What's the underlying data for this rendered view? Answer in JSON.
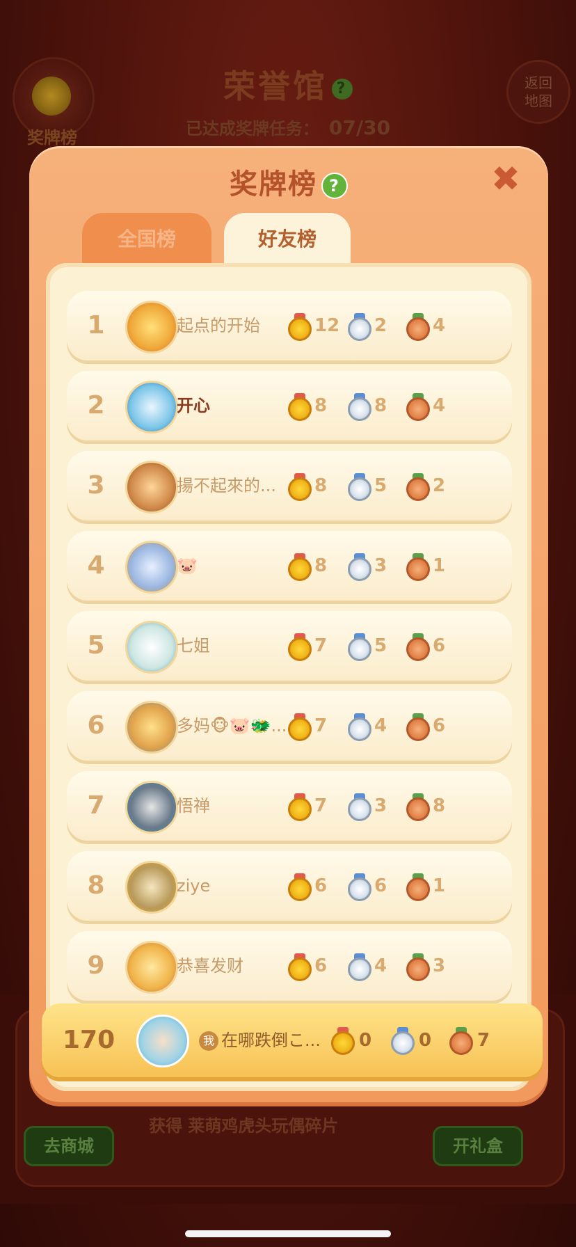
{
  "background": {
    "title": "荣誉馆",
    "help_icon": "?",
    "progress_label": "已达成奖牌任务：",
    "progress_value": "07/30",
    "left_button_label": "奖牌榜",
    "right_button_label": "返回\n地图",
    "shop_button": "去商城",
    "gift_button": "开礼盒",
    "reward_text": "获得 莱萌鸡虎头玩偶碎片"
  },
  "modal": {
    "title": "奖牌榜",
    "help_icon": "?",
    "close_icon": "✖",
    "tabs": [
      {
        "label": "全国榜",
        "active": false
      },
      {
        "label": "好友榜",
        "active": true
      }
    ]
  },
  "leaderboard": [
    {
      "rank": "1",
      "name": "起点的开始",
      "gold": "12",
      "silver": "2",
      "bronze": "4",
      "avatar": "avatar-icon"
    },
    {
      "rank": "2",
      "name": "开心",
      "gold": "8",
      "silver": "8",
      "bronze": "4",
      "avatar": "avatar-icon"
    },
    {
      "rank": "3",
      "name": "揚不起來的...",
      "gold": "8",
      "silver": "5",
      "bronze": "2",
      "avatar": "avatar-icon"
    },
    {
      "rank": "4",
      "name": "🐷",
      "gold": "8",
      "silver": "3",
      "bronze": "1",
      "avatar": "avatar-icon"
    },
    {
      "rank": "5",
      "name": "七姐",
      "gold": "7",
      "silver": "5",
      "bronze": "6",
      "avatar": "avatar-icon"
    },
    {
      "rank": "6",
      "name": "多妈🐵🐷🐲...",
      "gold": "7",
      "silver": "4",
      "bronze": "6",
      "avatar": "avatar-icon"
    },
    {
      "rank": "7",
      "name": "悟禅",
      "gold": "7",
      "silver": "3",
      "bronze": "8",
      "avatar": "avatar-icon"
    },
    {
      "rank": "8",
      "name": "ziye",
      "gold": "6",
      "silver": "6",
      "bronze": "1",
      "avatar": "avatar-icon"
    },
    {
      "rank": "9",
      "name": "恭喜发财",
      "gold": "6",
      "silver": "4",
      "bronze": "3",
      "avatar": "avatar-icon"
    }
  ],
  "my_entry": {
    "rank": "170",
    "badge": "我",
    "name": "在哪跌倒こ...",
    "gold": "0",
    "silver": "0",
    "bronze": "7"
  },
  "colors": {
    "gold_medal": "#f0b51a",
    "silver_medal": "#dbe4ee",
    "bronze_medal": "#e2844a",
    "modal_bg": "#f29a5d",
    "help_green": "#62b33a"
  }
}
